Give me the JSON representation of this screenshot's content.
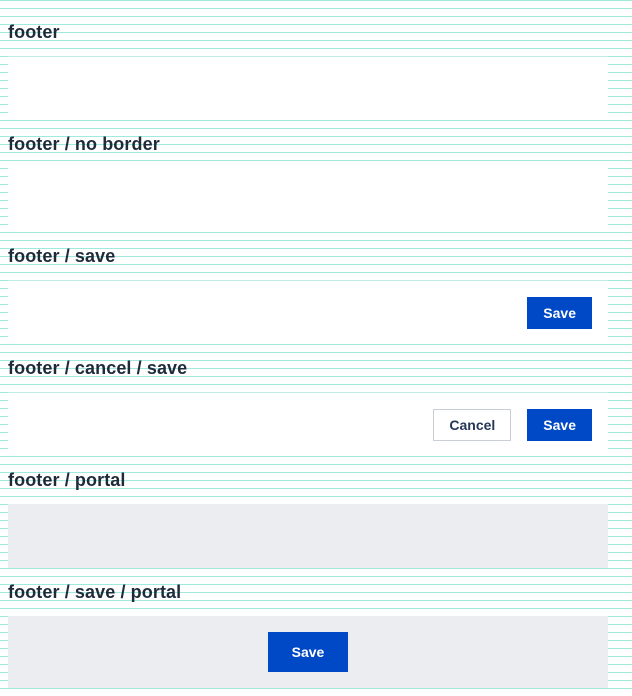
{
  "sections": [
    {
      "title": "footer"
    },
    {
      "title": "footer / no border"
    },
    {
      "title": "footer / save",
      "save_label": "Save"
    },
    {
      "title": "footer / cancel / save",
      "cancel_label": "Cancel",
      "save_label": "Save"
    },
    {
      "title": "footer / portal"
    },
    {
      "title": "footer / save / portal",
      "save_label": "Save"
    }
  ],
  "colors": {
    "primary": "#0049c6",
    "portal_bg": "#ebedf1",
    "grid_line": "#9feadd",
    "title_text": "#1f2b3a"
  }
}
